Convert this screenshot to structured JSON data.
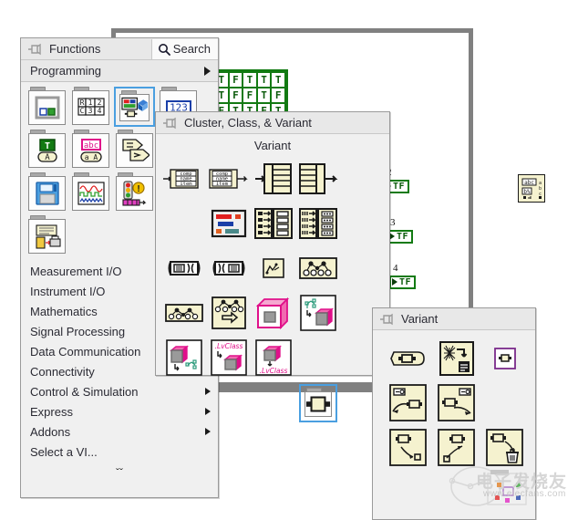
{
  "functions_palette": {
    "title": "Functions",
    "pin_icon": "pushpin-icon",
    "search": {
      "label": "Search",
      "icon": "search-icon"
    },
    "breadcrumb": {
      "label": "Programming",
      "arrow_icon": "triangle-right-icon"
    },
    "categories": [
      {
        "label": "Structures",
        "icon": "structures-folder-icon",
        "selected": false
      },
      {
        "label": "Array",
        "icon": "array-folder-icon",
        "selected": false
      },
      {
        "label": "Cluster, Class, & Variant",
        "icon": "cluster-folder-icon",
        "selected": true
      },
      {
        "label": "Numeric",
        "icon": "numeric-folder-icon",
        "selected": false
      },
      {
        "label": "Boolean",
        "icon": "boolean-folder-icon",
        "selected": false
      },
      {
        "label": "String",
        "icon": "string-folder-icon",
        "selected": false
      },
      {
        "label": "Comparison",
        "icon": "comparison-folder-icon",
        "selected": false
      },
      {
        "label": "Dialog & User Interface",
        "icon": "dialog-folder-icon",
        "selected": false
      },
      {
        "label": "File I/O",
        "icon": "file-io-folder-icon",
        "selected": false
      },
      {
        "label": "Waveform",
        "icon": "waveform-folder-icon",
        "selected": false
      },
      {
        "label": "Synchronization",
        "icon": "synchronization-folder-icon",
        "selected": false
      },
      {
        "label": "Graphics & Sound",
        "icon": "graphics-sound-folder-icon",
        "selected": false
      },
      {
        "label": "Report Generation",
        "icon": "report-generation-folder-icon",
        "selected": false
      }
    ],
    "menu_items": [
      {
        "label": "Measurement I/O",
        "submenu": false
      },
      {
        "label": "Instrument I/O",
        "submenu": false
      },
      {
        "label": "Mathematics",
        "submenu": false
      },
      {
        "label": "Signal Processing",
        "submenu": false
      },
      {
        "label": "Data Communication",
        "submenu": false
      },
      {
        "label": "Connectivity",
        "submenu": true
      },
      {
        "label": "Control & Simulation",
        "submenu": true
      },
      {
        "label": "Express",
        "submenu": true
      },
      {
        "label": "Addons",
        "submenu": true
      },
      {
        "label": "Select a VI...",
        "submenu": false
      }
    ],
    "more_chevron": "ˇˇ"
  },
  "cluster_palette": {
    "title": "Cluster, Class, & Variant",
    "pin_icon": "pushpin-icon",
    "hover_label": "Variant",
    "nodes": [
      {
        "name": "unbundle",
        "icon": "unbundle-icon"
      },
      {
        "name": "bundle",
        "icon": "bundle-icon"
      },
      {
        "name": "bundle-by-name",
        "icon": "bundle-by-name-icon"
      },
      {
        "name": "unbundle-by-name",
        "icon": "unbundle-by-name-icon"
      },
      {
        "name": "cluster-constant",
        "icon": "cluster-constant-icon"
      },
      {
        "name": "array-to-cluster",
        "icon": "array-to-cluster-icon"
      },
      {
        "name": "cluster-to-array",
        "icon": "cluster-to-array-icon"
      },
      {
        "name": "build-cluster-array",
        "icon": "build-cluster-array-icon"
      },
      {
        "name": "index-bundle-cluster-array",
        "icon": "index-bundle-cluster-array-icon"
      },
      {
        "name": "class-specifier-constant",
        "icon": "class-specifier-icon"
      },
      {
        "name": "to-more-specific-class",
        "icon": "to-more-specific-class-icon"
      },
      {
        "name": "to-more-generic-class",
        "icon": "to-more-generic-class-icon"
      },
      {
        "name": "preserve-run-time-class",
        "icon": "preserve-run-time-class-icon"
      },
      {
        "name": "lvclass-constant",
        "icon": "lvclass-constant-icon"
      },
      {
        "name": "get-lv-class-default",
        "icon": "get-lv-class-default-icon"
      },
      {
        "name": "get-lv-class-path",
        "icon": "get-lv-class-path-icon"
      },
      {
        "name": "get-lv-class-name",
        "icon": "get-lv-class-name-icon"
      },
      {
        "name": "variant-subpalette",
        "icon": "variant-folder-icon"
      }
    ],
    "node_labels": {
      "comp": "comp",
      "name": "name",
      "item": "item",
      "lvclass": ".LvClass"
    }
  },
  "variant_palette": {
    "title": "Variant",
    "pin_icon": "pushpin-icon",
    "nodes": [
      {
        "name": "variant-constant",
        "icon": "variant-constant-icon"
      },
      {
        "name": "flatten-to-string",
        "icon": "flatten-to-string-icon"
      },
      {
        "name": "variant-control",
        "icon": "variant-control-icon"
      },
      {
        "name": "to-variant",
        "icon": "to-variant-icon"
      },
      {
        "name": "variant-to-data",
        "icon": "variant-to-data-icon"
      },
      {
        "name": "set-variant-attribute",
        "icon": "set-variant-attribute-icon"
      },
      {
        "name": "get-variant-attribute",
        "icon": "get-variant-attribute-icon"
      },
      {
        "name": "delete-variant-attribute",
        "icon": "delete-variant-attribute-icon"
      }
    ]
  },
  "block_diagram": {
    "boolean_array": {
      "name": "boolean-array-constant",
      "rows": [
        [
          "T",
          "F",
          "T",
          "T",
          "T"
        ],
        [
          "T",
          "F",
          "F",
          "T",
          "F"
        ],
        [
          "F",
          "T",
          "T",
          "F",
          "T"
        ]
      ]
    },
    "indicators": [
      {
        "label": "2",
        "value": "TF"
      },
      {
        "label": "3",
        "value": "TF"
      },
      {
        "label": "4",
        "value": "TF"
      }
    ],
    "variant_node": {
      "name": "variant-to-data-node",
      "label": "abc"
    }
  },
  "watermark": {
    "text": "电子发烧友",
    "url": "www.elecfans.com"
  },
  "colors": {
    "palette_bg": "#f0f0f0",
    "title_bg": "#e8e8e8",
    "border": "#9a9a9a",
    "selection": "#4a9fe0",
    "node_fill": "#f5f2cf",
    "boolean_green": "#127a12",
    "class_magenta": "#e0108a",
    "window_border": "#808080"
  }
}
